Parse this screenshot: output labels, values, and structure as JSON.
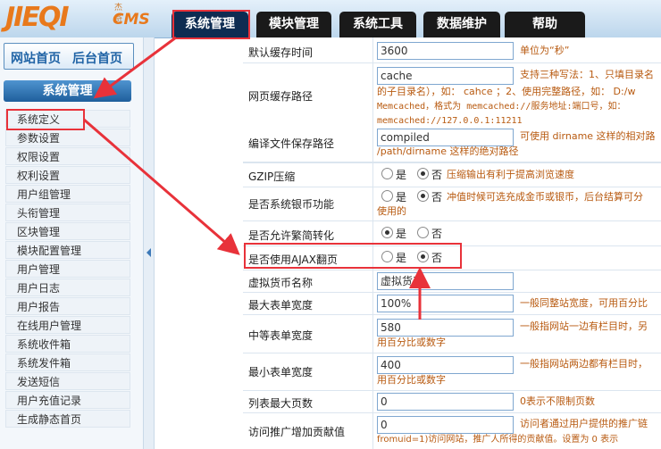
{
  "logo": {
    "mark": "JIEQI",
    "cms": "CMS",
    "small": "杰奇"
  },
  "tabs": [
    {
      "label": "系统管理",
      "active": true
    },
    {
      "label": "模块管理"
    },
    {
      "label": "系统工具"
    },
    {
      "label": "数据维护"
    },
    {
      "label": "帮助"
    }
  ],
  "sidebar": {
    "site_home": "网站首页",
    "admin_home": "后台首页",
    "section_title": "系统管理",
    "items": [
      "系统定义",
      "参数设置",
      "权限设置",
      "权利设置",
      "用户组管理",
      "头衔管理",
      "区块管理",
      "模块配置管理",
      "用户管理",
      "用户日志",
      "用户报告",
      "在线用户管理",
      "系统收件箱",
      "系统发件箱",
      "发送短信",
      "用户充值记录",
      "生成静态首页"
    ]
  },
  "settings": {
    "cache_time": {
      "label": "默认缓存时间",
      "value": "3600",
      "hint": "单位为“秒”"
    },
    "cache_path": {
      "label": "网页缓存路径",
      "value": "cache",
      "hint_1": "支持三种写法：1、只填目录名",
      "hint_2": "的子目录名），如： cahce ；2、使用完整路径，如： D:/w",
      "hint_3": "Memcached，格式为 memcached://服务地址:端口号，如：",
      "hint_4": "memcached://127.0.0.1:11211"
    },
    "compile_path": {
      "label": "编译文件保存路径",
      "value": "compiled",
      "hint_1": "可使用 dirname 这样的相对路",
      "hint_2": "/path/dirname 这样的绝对路径"
    },
    "gzip": {
      "label": "GZIP压缩",
      "yes": "是",
      "no": "否",
      "hint": "压缩输出有利于提高浏览速度"
    },
    "silver": {
      "label": "是否系统银币功能",
      "yes": "是",
      "no": "否",
      "hint_1": "冲值时候可选充成金币或银币，后台结算可分",
      "hint_2": "使用的"
    },
    "simp_trad": {
      "label": "是否允许繁简转化",
      "yes": "是",
      "no": "否"
    },
    "ajax_page": {
      "label": "是否使用AJAX翻页",
      "yes": "是",
      "no": "否"
    },
    "currency_name": {
      "label": "虚拟货币名称",
      "value": "虚拟货币"
    },
    "max_width": {
      "label": "最大表单宽度",
      "value": "100%",
      "hint": "一般同整站宽度，可用百分比"
    },
    "mid_width": {
      "label": "中等表单宽度",
      "value": "580",
      "hint_1": "一般指网站一边有栏目时，另",
      "hint_2": "用百分比或数字"
    },
    "min_width": {
      "label": "最小表单宽度",
      "value": "400",
      "hint_1": "一般指网站两边都有栏目时，",
      "hint_2": "用百分比或数字"
    },
    "max_pages": {
      "label": "列表最大页数",
      "value": "0",
      "hint": "0表示不限制页数"
    },
    "promo_points": {
      "label": "访问推广增加贡献值",
      "value": "0",
      "hint_1": "访问者通过用户提供的推广链",
      "hint_2": "fromuid=1)访问网站，推广人所得的贡献值。设置为 0 表示"
    }
  },
  "colors": {
    "annotation": "#e8323a",
    "tab_active": "#0e2c52",
    "hint_text": "#b85a10"
  }
}
